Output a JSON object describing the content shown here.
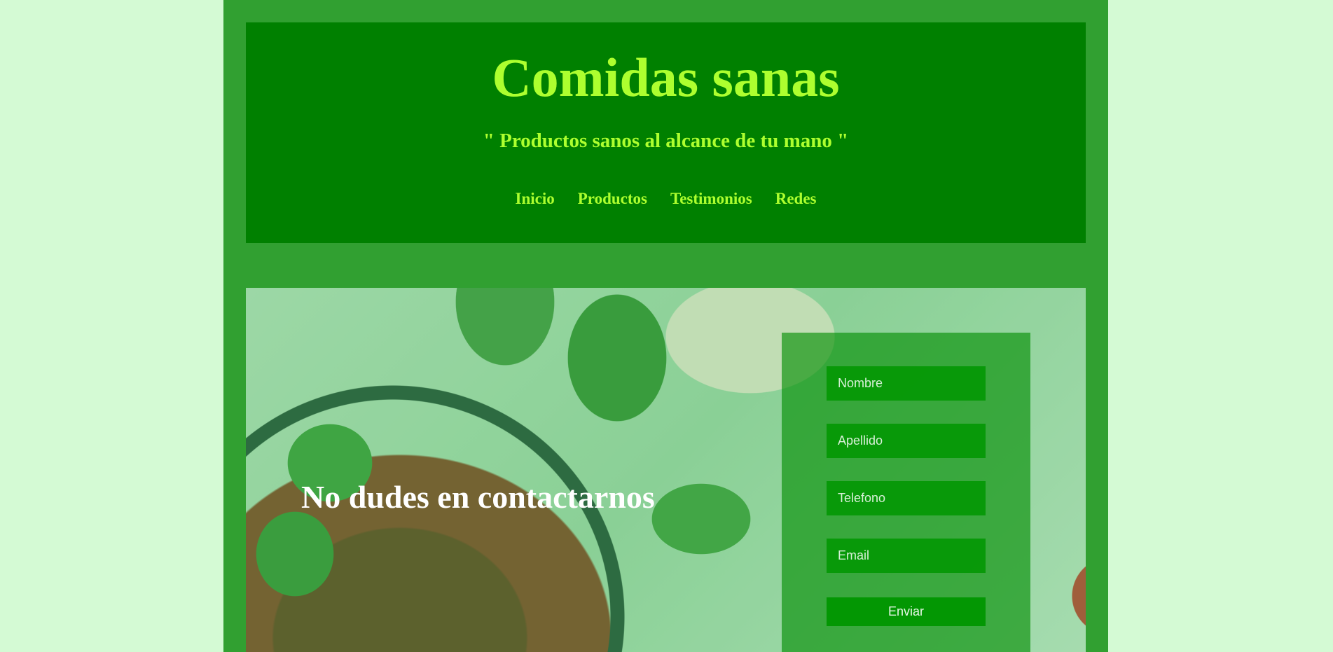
{
  "header": {
    "title": "Comidas sanas",
    "tagline": "\" Productos sanos al alcance de tu mano \""
  },
  "nav": {
    "items": [
      {
        "label": "Inicio"
      },
      {
        "label": "Productos"
      },
      {
        "label": "Testimonios"
      },
      {
        "label": "Redes"
      }
    ]
  },
  "contact": {
    "heading": "No dudes en contactarnos",
    "form": {
      "nombre_placeholder": "Nombre",
      "apellido_placeholder": "Apellido",
      "telefono_placeholder": "Telefono",
      "email_placeholder": "Email",
      "submit_label": "Enviar"
    }
  },
  "colors": {
    "page_bg": "#d4fad4",
    "wrapper_bg": "#31a031",
    "header_bg": "#008000",
    "accent_text": "#adff2f"
  }
}
